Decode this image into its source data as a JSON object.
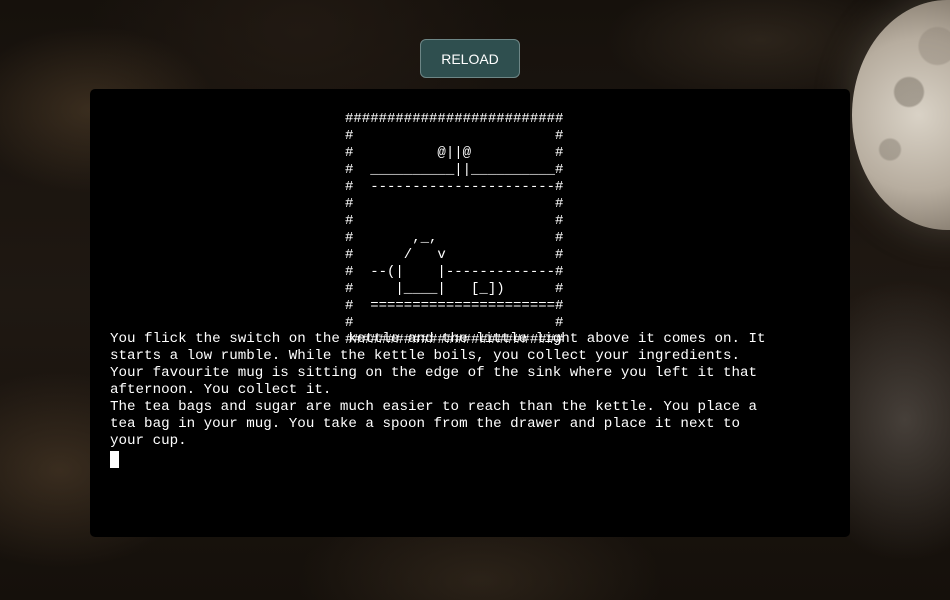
{
  "header": {
    "reload_label": "RELOAD"
  },
  "terminal": {
    "ascii_art": "##########################\n#                        #\n#          @||@          #\n#  __________||__________#\n#  ----------------------#\n#                        #\n#                        #\n#       ,_,              #\n#      /   v             #\n#  --(|    |-------------#\n#     |____|   [_])      #\n#  ======================#\n#                        #\n##########################",
    "story_lines": [
      "You flick the switch on the kettle and the little light above it comes on. It",
      "starts a low rumble. While the kettle boils, you collect your ingredients.",
      "Your favourite mug is sitting on the edge of the sink where you left it that",
      "afternoon. You collect it.",
      "The tea bags and sugar are much easier to reach than the kettle. You place a",
      "tea bag in your mug. You take a spoon from the drawer and place it next to",
      "your cup."
    ]
  },
  "colors": {
    "button_bg": "#2f4f4f",
    "terminal_bg": "#000000",
    "text": "#ffffff"
  }
}
